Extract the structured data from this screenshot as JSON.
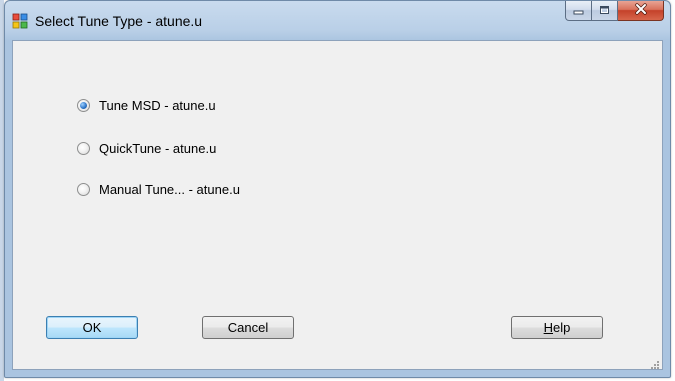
{
  "window": {
    "title": "Select Tune Type - atune.u"
  },
  "caption_buttons": {
    "minimize_icon": "minimize-icon",
    "maximize_icon": "maximize-icon",
    "close_icon": "close-icon"
  },
  "options": [
    {
      "label": "Tune MSD - atune.u",
      "checked": true
    },
    {
      "label": "QuickTune - atune.u",
      "checked": false
    },
    {
      "label": "Manual Tune... - atune.u",
      "checked": false
    }
  ],
  "buttons": {
    "ok": "OK",
    "cancel": "Cancel",
    "help_accel": "H",
    "help_rest": "elp"
  },
  "colors": {
    "titlebar": "#b9cfe7",
    "client_bg": "#f0f0f0",
    "default_button_border": "#3c7fb1",
    "close_button": "#c4412a"
  }
}
